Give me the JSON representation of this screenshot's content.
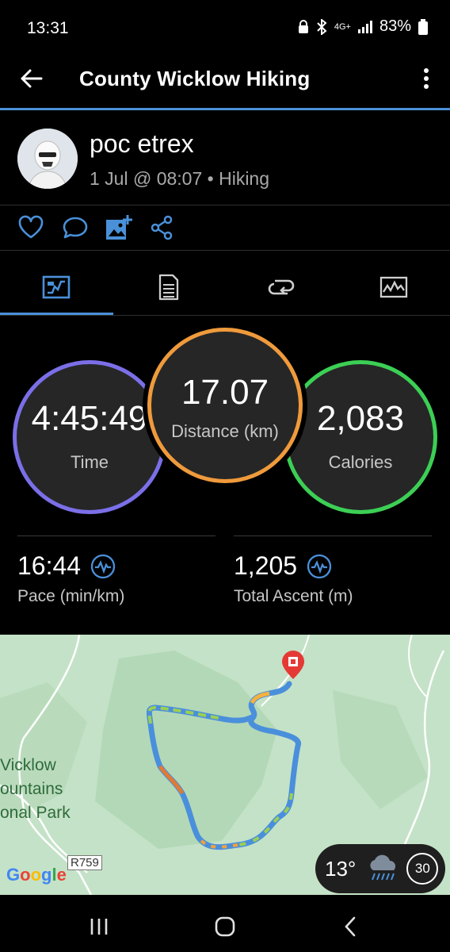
{
  "status": {
    "time": "13:31",
    "battery": "83%",
    "network": "4G+"
  },
  "appbar": {
    "title": "County Wicklow Hiking"
  },
  "user": {
    "name": "poc etrex",
    "meta": "1 Jul @ 08:07 • Hiking"
  },
  "actions": [
    "heart-icon",
    "comment-icon",
    "add-photo-icon",
    "share-icon"
  ],
  "tabs": [
    "stats-tab",
    "details-tab",
    "laps-tab",
    "charts-tab"
  ],
  "summary": {
    "time": {
      "value": "4:45:49",
      "label": "Time",
      "color": "#7b6fe8"
    },
    "distance": {
      "value": "17.07",
      "label": "Distance (km)",
      "color": "#ef9a3c"
    },
    "calories": {
      "value": "2,083",
      "label": "Calories",
      "color": "#3ccf55"
    }
  },
  "stats": {
    "pace": {
      "value": "16:44",
      "label": "Pace (min/km)"
    },
    "ascent": {
      "value": "1,205",
      "label": "Total Ascent (m)"
    }
  },
  "map": {
    "park_line1": "Vicklow",
    "park_line2": "ountains",
    "park_line3": "onal Park",
    "road": "R759",
    "attribution": "Google",
    "weather_temp": "13°",
    "weather_wind": "30"
  },
  "colors": {
    "accent": "#4a90d9",
    "map_bg": "#c4e2c7"
  }
}
